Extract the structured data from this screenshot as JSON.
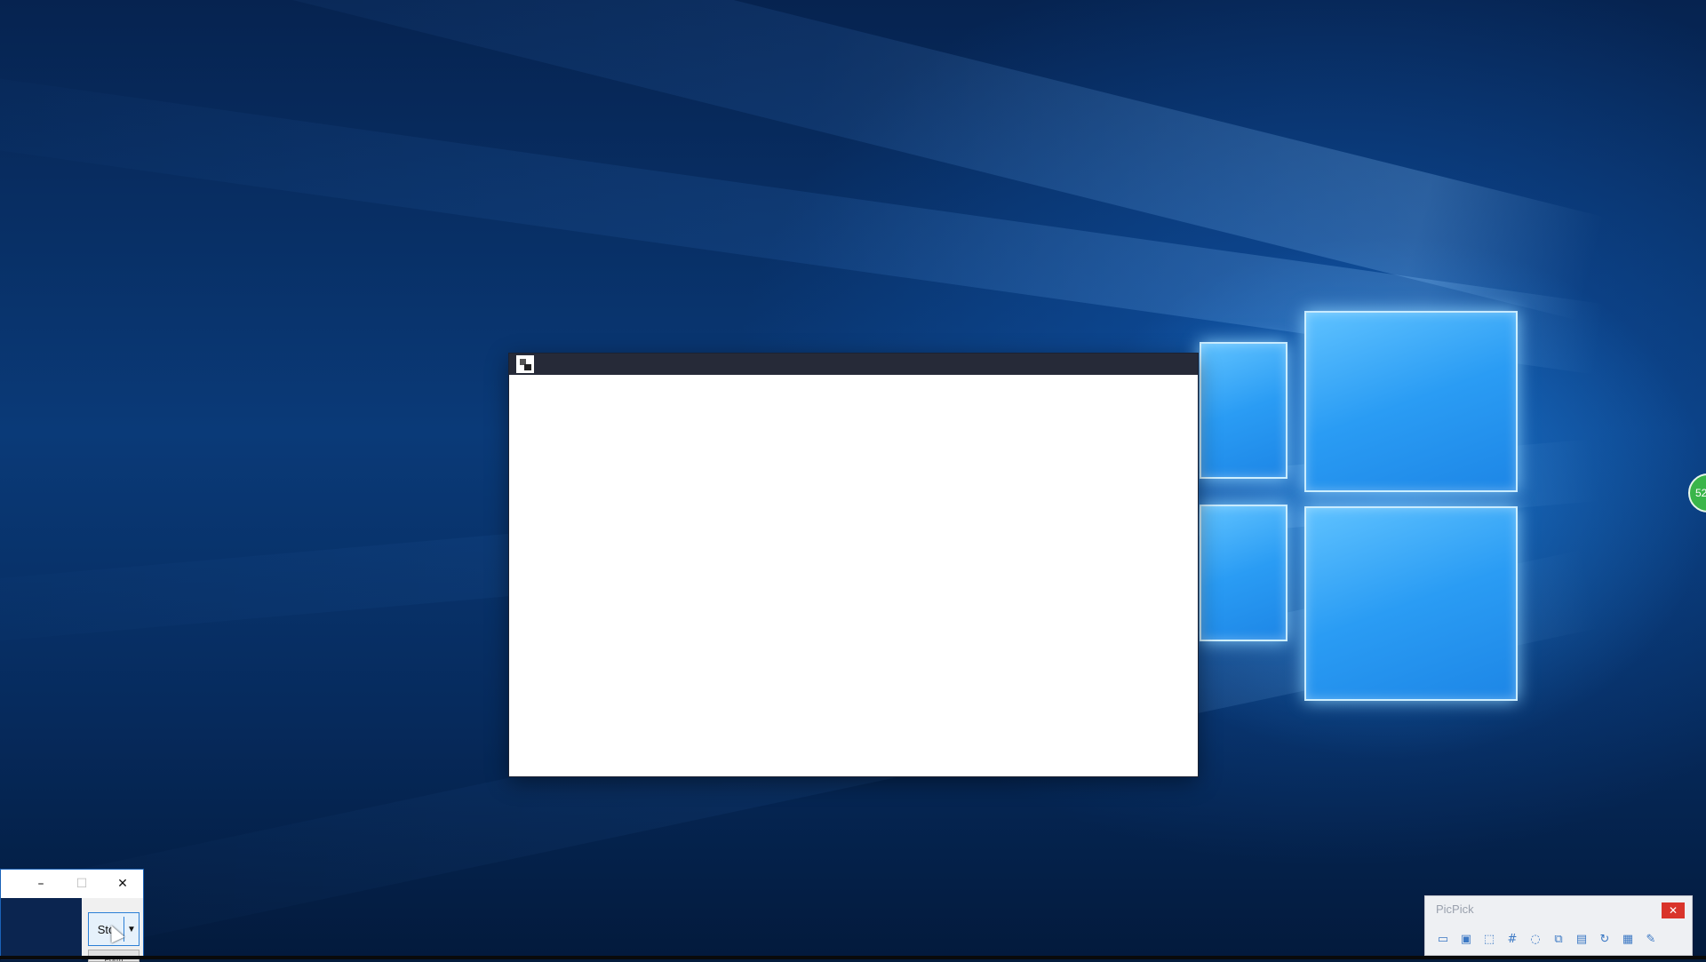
{
  "small_window": {
    "minimize": "–",
    "maximize": "☐",
    "close": "✕",
    "split_button_label": "Sto",
    "split_button_arrow": "▼",
    "second_button_label": "Form"
  },
  "picpick": {
    "title": "PicPick",
    "close": "✕",
    "tools": [
      {
        "icon": "fullscreen-capture-icon",
        "glyph": "▭"
      },
      {
        "icon": "window-capture-icon",
        "glyph": "▣"
      },
      {
        "icon": "region-capture-icon",
        "glyph": "⬚"
      },
      {
        "icon": "grid-capture-icon",
        "glyph": "#"
      },
      {
        "icon": "freehand-capture-icon",
        "glyph": "◌"
      },
      {
        "icon": "scroll-capture-icon",
        "glyph": "⧉"
      },
      {
        "icon": "fixed-region-icon",
        "glyph": "▤"
      },
      {
        "icon": "repeat-capture-icon",
        "glyph": "↻"
      },
      {
        "icon": "output-icon",
        "glyph": "▦"
      },
      {
        "icon": "tools-icon",
        "glyph": "✎"
      }
    ]
  },
  "badge": {
    "text": "52"
  }
}
